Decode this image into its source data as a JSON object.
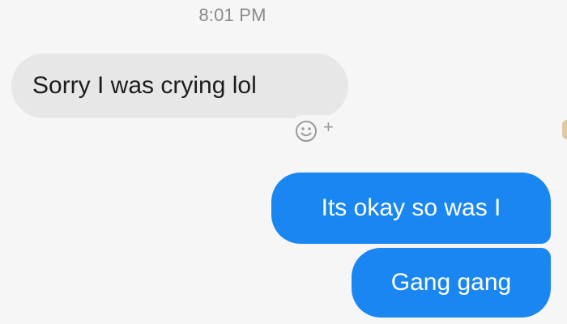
{
  "timestamp": "8:01 PM",
  "messages": [
    {
      "direction": "incoming",
      "text": "Sorry I was crying lol"
    },
    {
      "direction": "outgoing",
      "text": "Its okay so was I"
    },
    {
      "direction": "outgoing",
      "text": "Gang gang"
    }
  ],
  "reaction_button": {
    "icon": "smiley-face-icon",
    "plus_symbol": "+"
  },
  "colors": {
    "background": "#f6f6f6",
    "incoming_bubble": "#e7e7e7",
    "outgoing_bubble": "#1a86f1",
    "timestamp_text": "#8a8a8a"
  }
}
